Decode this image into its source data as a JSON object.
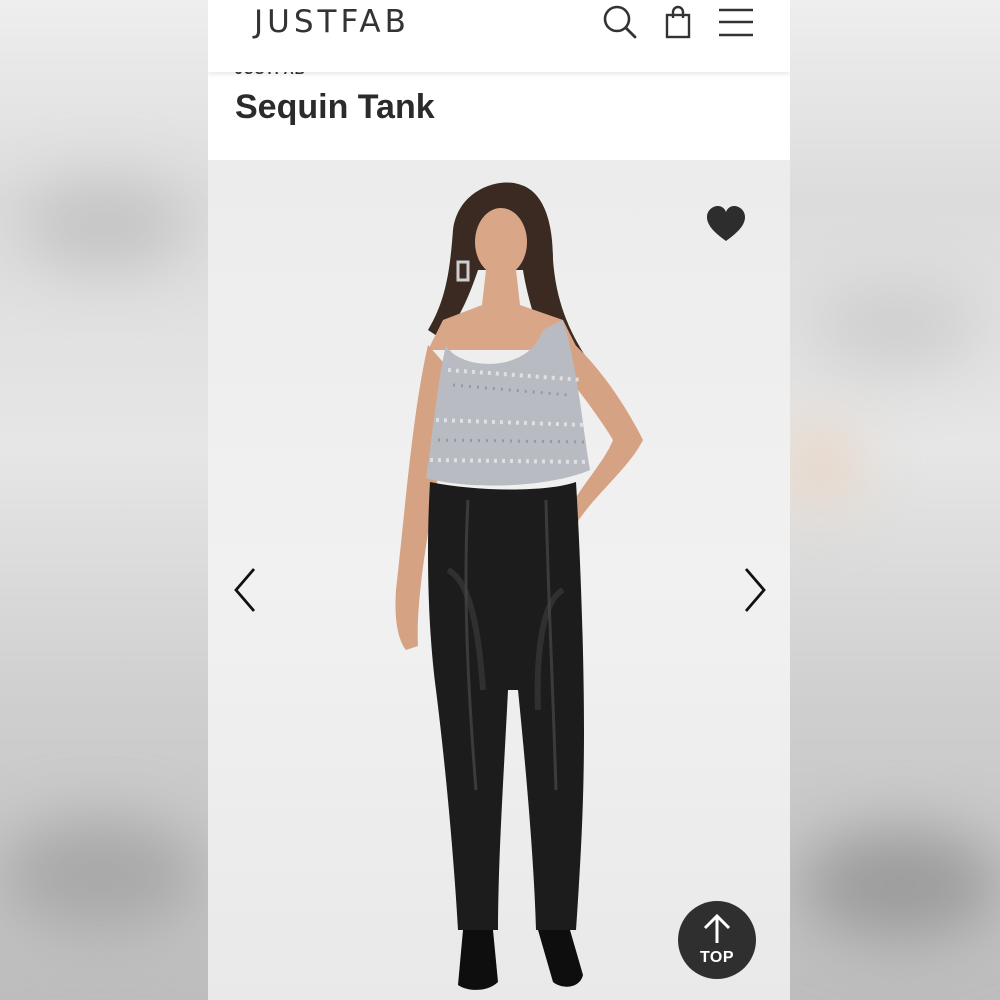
{
  "header": {
    "logo": "JUSTFAB",
    "icons": [
      "search-icon",
      "shopping-bag-icon",
      "menu-icon"
    ]
  },
  "product": {
    "brand": "JUSTFAB",
    "title": "Sequin Tank"
  },
  "gallery": {
    "icons": [
      "heart-icon",
      "chevron-left-icon",
      "chevron-right-icon",
      "arrow-up-icon"
    ],
    "top_button_label": "TOP"
  },
  "colors": {
    "text": "#333333",
    "top_button_bg": "#2f2f2f",
    "gallery_bg": "#eeeeee",
    "sequin": "#b8bcc2",
    "leather": "#1c1c1c"
  }
}
